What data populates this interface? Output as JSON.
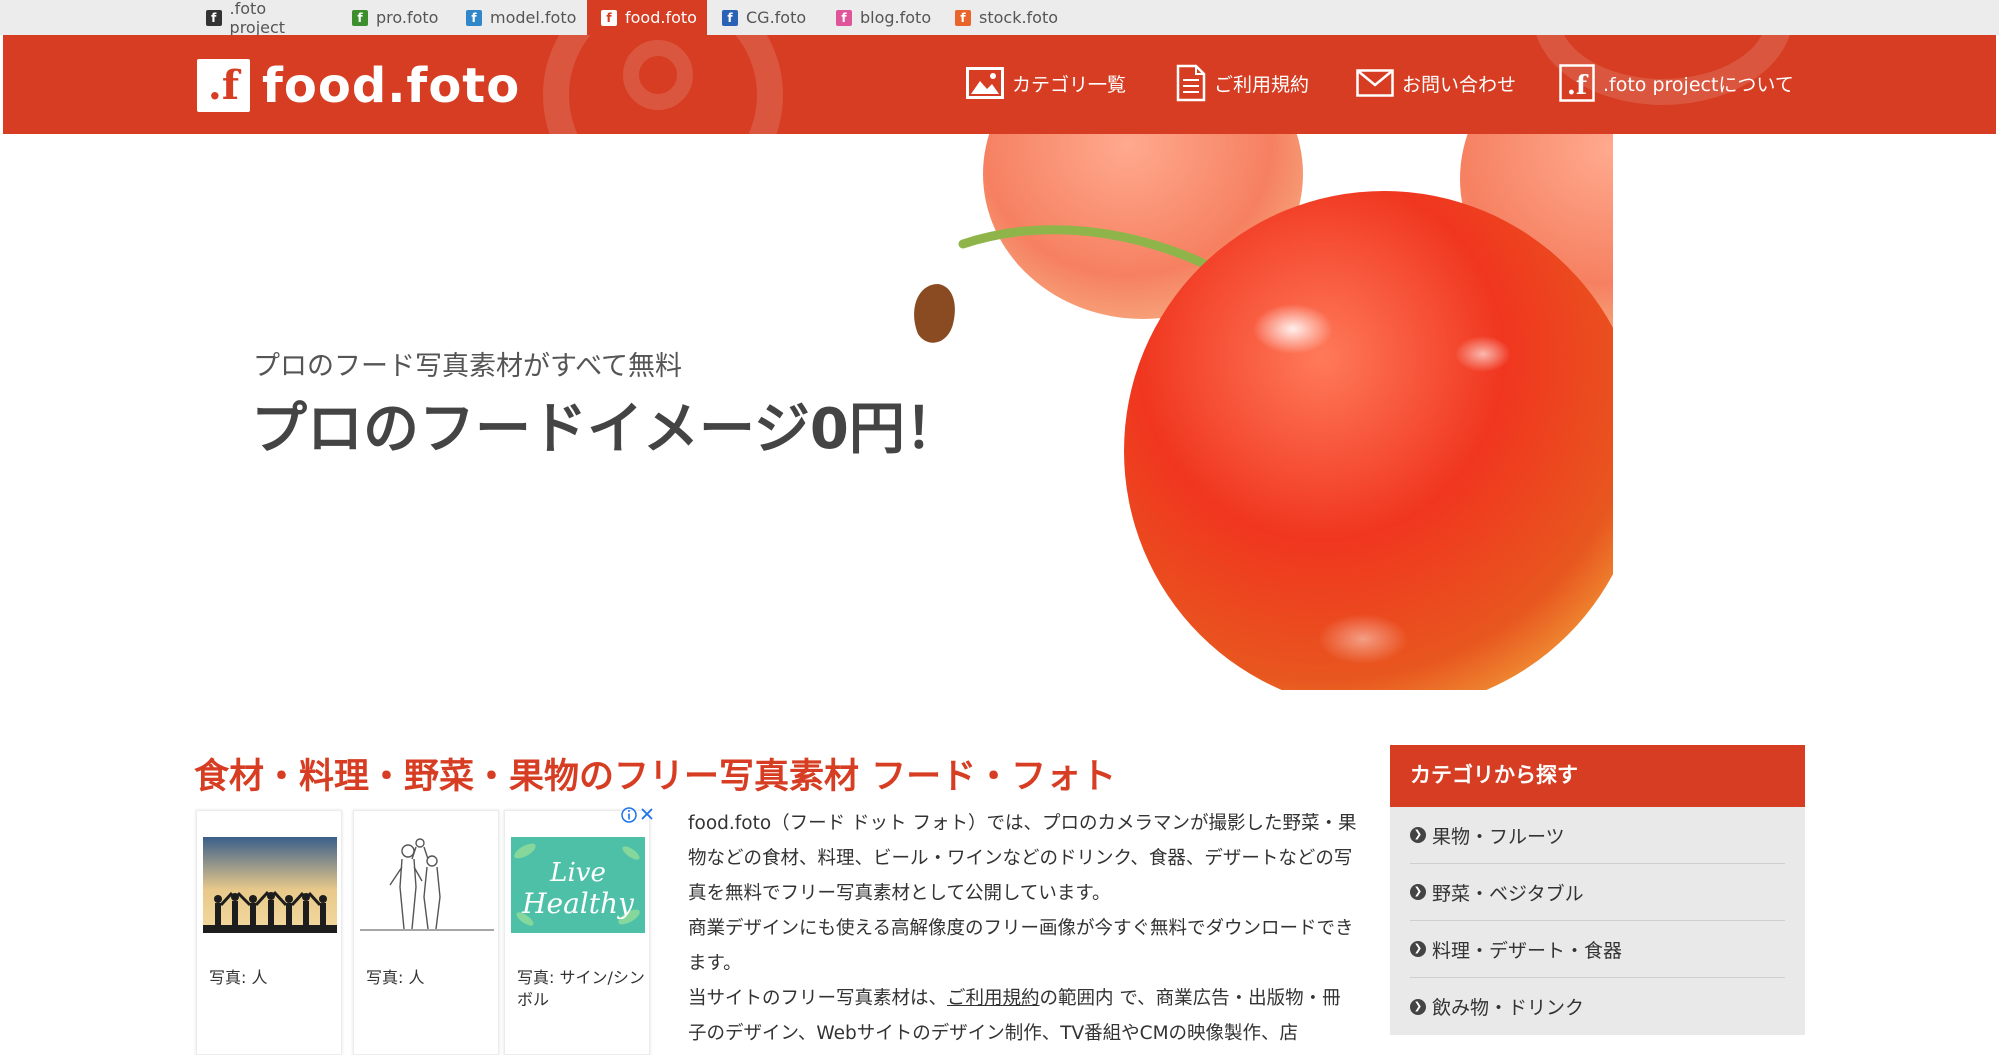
{
  "site_tabs": [
    {
      "label": ".foto project",
      "color": "#333333",
      "active": false
    },
    {
      "label": "pro.foto",
      "color": "#3c8f2c",
      "active": false
    },
    {
      "label": "model.foto",
      "color": "#2f86c8",
      "active": false
    },
    {
      "label": "food.foto",
      "color": "#d63d22",
      "active": true
    },
    {
      "label": "CG.foto",
      "color": "#2a63b5",
      "active": false
    },
    {
      "label": "blog.foto",
      "color": "#e0559a",
      "active": false
    },
    {
      "label": "stock.foto",
      "color": "#e8642a",
      "active": false
    }
  ],
  "header": {
    "logo_mark": ".f",
    "logo_text": "food.foto",
    "nav": [
      {
        "label": "カテゴリ一覧",
        "icon": "image-icon"
      },
      {
        "label": "ご利用規約",
        "icon": "document-icon"
      },
      {
        "label": "お問い合わせ",
        "icon": "mail-icon"
      },
      {
        "label": ".foto projectについて",
        "icon": "foto-logo-icon"
      }
    ]
  },
  "hero": {
    "subtitle": "プロのフード写真素材がすべて無料",
    "title": "プロのフードイメージ0円！"
  },
  "main": {
    "title": "食材・料理・野菜・果物のフリー写真素材 フード・フォト",
    "body": {
      "p1": "food.foto（フード ドット フォト）では、プロのカメラマンが撮影した野菜・果物などの食材、料理、ビール・ワインなどのドリンク、食器、デザートなどの写真を無料でフリー写真素材として公開しています。",
      "p2": "商業デザインにも使える高解像度のフリー画像が今すぐ無料でダウンロードできます。",
      "p3_before": "当サイトのフリー写真素材は、",
      "p3_link": "ご利用規約",
      "p3_after": "の範囲内 で、商業広告・出版物・冊子のデザイン、Webサイトのデザイン制作、TV番組やCMの映像製作、店"
    }
  },
  "ads": {
    "items": [
      {
        "caption": "写真: 人"
      },
      {
        "caption": "写真: 人"
      },
      {
        "caption": "写真: サイン/シンボル"
      }
    ],
    "image_text": "Live Healthy"
  },
  "sidebar": {
    "title": "カテゴリから探す",
    "items": [
      {
        "label": "果物・フルーツ"
      },
      {
        "label": "野菜・ベジタブル"
      },
      {
        "label": "料理・デザート・食器"
      },
      {
        "label": "飲み物・ドリンク"
      }
    ]
  },
  "colors": {
    "accent": "#d63d22",
    "sidebar_bg": "#e9e9e9",
    "topbar_bg": "#ececec"
  }
}
